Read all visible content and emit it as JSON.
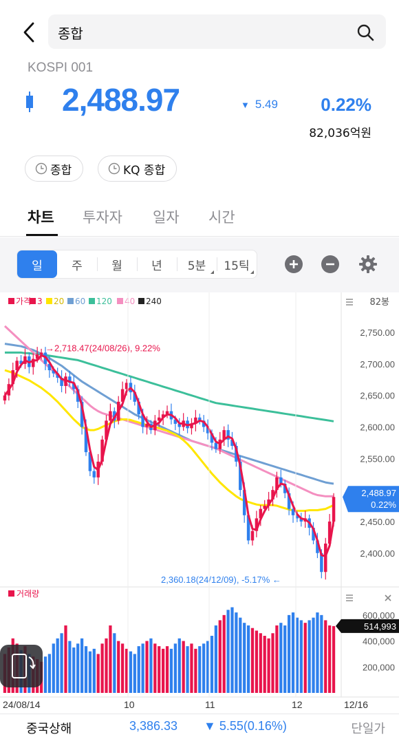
{
  "header": {
    "search_text": "종합",
    "market_code": "KOSPI 001",
    "price": "2,488.97",
    "change": "5.49",
    "change_pct": "0.22%",
    "trade_value": "82,036억원",
    "chips": [
      "종합",
      "KQ 종합"
    ]
  },
  "tabs": [
    "차트",
    "투자자",
    "일자",
    "시간"
  ],
  "chart_controls": {
    "periods": [
      "일",
      "주",
      "월",
      "년",
      "5분",
      "15틱"
    ],
    "active_period": "일"
  },
  "colors": {
    "up": "#e8154c",
    "down": "#2f80ed",
    "ma3": "#e8154c",
    "ma20": "#ffe600",
    "ma60": "#6f9fd3",
    "ma120": "#3cbf9a",
    "ma40": "#f48fc0",
    "ma240": "#222222"
  },
  "chart_data": {
    "type": "candlestick",
    "legend": [
      {
        "label": "가격",
        "color": "#e8154c"
      },
      {
        "label": "3",
        "color": "#e8154c"
      },
      {
        "label": "20",
        "color": "#ffe600"
      },
      {
        "label": "60",
        "color": "#6f9fd3"
      },
      {
        "label": "120",
        "color": "#3cbf9a"
      },
      {
        "label": "40",
        "color": "#f48fc0"
      },
      {
        "label": "240",
        "color": "#222222"
      }
    ],
    "bar_count_label": "82봉",
    "y_ticks": [
      "2,750.00",
      "2,700.00",
      "2,650.00",
      "2,600.00",
      "2,550.00",
      "2,500.00",
      "2,450.00",
      "2,400.00"
    ],
    "ylim": [
      2355,
      2785
    ],
    "x_ticks": [
      "24/08/14",
      "10",
      "11",
      "12",
      "12/16"
    ],
    "current_price_label": "2,488.97",
    "current_pct_label": "0.22%",
    "max_annotation": "2,718.47(24/08/26), 9.22%",
    "min_annotation": "2,360.18(24/12/09), -5.17%",
    "closes": [
      2650,
      2668,
      2690,
      2705,
      2700,
      2712,
      2695,
      2708,
      2715,
      2718,
      2700,
      2690,
      2685,
      2678,
      2665,
      2680,
      2670,
      2660,
      2640,
      2600,
      2560,
      2530,
      2520,
      2545,
      2580,
      2610,
      2625,
      2610,
      2640,
      2660,
      2670,
      2655,
      2640,
      2620,
      2600,
      2605,
      2595,
      2610,
      2615,
      2620,
      2625,
      2612,
      2605,
      2600,
      2610,
      2598,
      2605,
      2615,
      2610,
      2600,
      2590,
      2575,
      2565,
      2580,
      2595,
      2580,
      2570,
      2545,
      2500,
      2460,
      2420,
      2435,
      2455,
      2470,
      2475,
      2485,
      2500,
      2520,
      2510,
      2495,
      2470,
      2460,
      2455,
      2450,
      2455,
      2440,
      2420,
      2400,
      2370,
      2415,
      2450,
      2488.97
    ],
    "ma20": [
      2690,
      2688,
      2686,
      2683,
      2680,
      2677,
      2674,
      2670,
      2666,
      2662,
      2657,
      2652,
      2646,
      2640,
      2633,
      2626,
      2619,
      2612,
      2606,
      2600,
      2597,
      2595,
      2595,
      2597,
      2600,
      2603,
      2606,
      2609,
      2611,
      2612,
      2612,
      2611,
      2609,
      2607,
      2605,
      2603,
      2601,
      2600,
      2598,
      2596,
      2594,
      2591,
      2588,
      2584,
      2579,
      2573,
      2566,
      2558,
      2550,
      2542,
      2534,
      2526,
      2519,
      2512,
      2506,
      2500,
      2495,
      2490,
      2486,
      2483,
      2481,
      2479,
      2477,
      2476,
      2476,
      2476,
      2476,
      2475,
      2473,
      2471,
      2469,
      2468,
      2467,
      2467,
      2467,
      2468,
      2468,
      2468,
      2469,
      2470,
      2473,
      2476
    ],
    "ma60": [
      2732,
      2731,
      2730,
      2729,
      2728,
      2726,
      2724,
      2722,
      2719,
      2716,
      2713,
      2709,
      2705,
      2701,
      2697,
      2692,
      2687,
      2682,
      2677,
      2672,
      2668,
      2664,
      2660,
      2656,
      2652,
      2648,
      2644,
      2640,
      2636,
      2632,
      2628,
      2624,
      2620,
      2617,
      2614,
      2611,
      2608,
      2605,
      2602,
      2599,
      2596,
      2593,
      2590,
      2587,
      2584,
      2581,
      2578,
      2576,
      2574,
      2572,
      2570,
      2568,
      2566,
      2564,
      2562,
      2560,
      2558,
      2556,
      2554,
      2552,
      2550,
      2548,
      2546,
      2544,
      2542,
      2540,
      2538,
      2536,
      2534,
      2532,
      2530,
      2528,
      2526,
      2524,
      2522,
      2520,
      2518,
      2516,
      2514,
      2512,
      2511,
      2510
    ],
    "ma120": [
      2718,
      2718,
      2718,
      2718,
      2718,
      2717,
      2717,
      2716,
      2716,
      2715,
      2714,
      2713,
      2712,
      2711,
      2710,
      2709,
      2708,
      2707,
      2706,
      2704,
      2702,
      2700,
      2698,
      2696,
      2694,
      2692,
      2690,
      2688,
      2686,
      2684,
      2682,
      2680,
      2678,
      2676,
      2674,
      2672,
      2670,
      2668,
      2666,
      2664,
      2662,
      2660,
      2658,
      2656,
      2654,
      2652,
      2650,
      2648,
      2646,
      2644,
      2642,
      2640,
      2638,
      2637,
      2636,
      2635,
      2634,
      2633,
      2632,
      2631,
      2630,
      2629,
      2628,
      2627,
      2626,
      2625,
      2624,
      2623,
      2622,
      2621,
      2620,
      2619,
      2618,
      2617,
      2616,
      2615,
      2614,
      2613,
      2612,
      2611,
      2610,
      2609
    ],
    "ma40": [
      2760,
      2754,
      2748,
      2742,
      2736,
      2730,
      2724,
      2718,
      2712,
      2706,
      2700,
      2694,
      2688,
      2682,
      2676,
      2670,
      2664,
      2658,
      2652,
      2646,
      2640,
      2634,
      2629,
      2625,
      2622,
      2620,
      2618,
      2616,
      2614,
      2612,
      2610,
      2608,
      2606,
      2604,
      2602,
      2600,
      2598,
      2596,
      2594,
      2592,
      2590,
      2588,
      2586,
      2584,
      2582,
      2580,
      2578,
      2576,
      2574,
      2572,
      2570,
      2568,
      2566,
      2563,
      2560,
      2557,
      2554,
      2551,
      2548,
      2545,
      2542,
      2539,
      2536,
      2533,
      2530,
      2527,
      2524,
      2521,
      2518,
      2515,
      2512,
      2509,
      2506,
      2503,
      2500,
      2497,
      2494,
      2492,
      2491,
      2490,
      2490,
      2490
    ],
    "volume": {
      "label": "거래량",
      "current_label": "514,993",
      "y_ticks": [
        "600,000",
        "400,000",
        "200,000"
      ],
      "ylim": [
        0,
        700000
      ],
      "values": [
        300000,
        350000,
        420000,
        380000,
        330000,
        360000,
        300000,
        280000,
        260000,
        240000,
        280000,
        300000,
        380000,
        420000,
        460000,
        520000,
        400000,
        350000,
        380000,
        420000,
        360000,
        320000,
        340000,
        300000,
        380000,
        420000,
        520000,
        460000,
        400000,
        380000,
        340000,
        320000,
        300000,
        360000,
        380000,
        400000,
        420000,
        380000,
        360000,
        340000,
        360000,
        340000,
        380000,
        420000,
        400000,
        360000,
        380000,
        340000,
        360000,
        380000,
        400000,
        440000,
        520000,
        560000,
        600000,
        640000,
        660000,
        620000,
        580000,
        540000,
        520000,
        500000,
        480000,
        460000,
        440000,
        420000,
        460000,
        520000,
        540000,
        520000,
        600000,
        620000,
        580000,
        560000,
        540000,
        560000,
        580000,
        620000,
        600000,
        560000,
        520000,
        514993
      ]
    }
  },
  "ticker": {
    "name": "중국상해",
    "price": "3,386.33",
    "change": "▼ 5.55(0.16%)",
    "side_label": "단일가"
  }
}
